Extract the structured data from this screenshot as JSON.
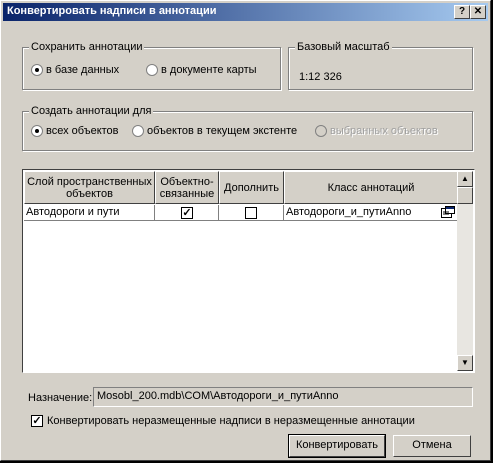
{
  "window": {
    "title": "Конвертировать надписи в аннотации",
    "help_label": "?",
    "close_label": "✕"
  },
  "save_group": {
    "legend": "Сохранить аннотации",
    "options": [
      {
        "label": "в базе данных",
        "selected": true
      },
      {
        "label": "в документе карты",
        "selected": false
      }
    ]
  },
  "scale_group": {
    "legend": "Базовый масштаб",
    "value": "1:12 326"
  },
  "create_group": {
    "legend": "Создать аннотации для",
    "options": [
      {
        "label": "всех объектов",
        "selected": true,
        "enabled": true
      },
      {
        "label": "объектов в текущем экстенте",
        "selected": false,
        "enabled": true
      },
      {
        "label": "выбранных объектов",
        "selected": false,
        "enabled": false
      }
    ]
  },
  "table": {
    "columns": [
      "Слой пространственных объектов",
      "Объектно-связанные",
      "Дополнить",
      "Класс аннотаций"
    ],
    "rows": [
      {
        "layer": "Автодороги и пути",
        "feature_linked": true,
        "append": false,
        "annotation_class": "Автодороги_и_путиAnno"
      }
    ]
  },
  "destination": {
    "label": "Назначение:",
    "value": "Mosobl_200.mdb\\COM\\Автодороги_и_путиAnno"
  },
  "convert_unplaced": {
    "label": "Конвертировать неразмещенные надписи в неразмещенные аннотации",
    "checked": true
  },
  "buttons": {
    "convert": "Конвертировать",
    "cancel": "Отмена"
  },
  "icons": {
    "class_properties": "properties-icon",
    "scroll_up": "arrow-up-icon",
    "scroll_down": "arrow-down-icon"
  }
}
